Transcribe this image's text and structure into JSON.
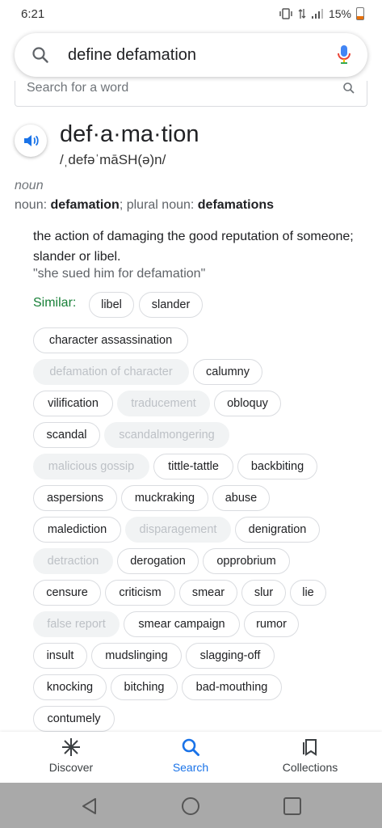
{
  "status": {
    "time": "6:21",
    "battery": "15%"
  },
  "search": {
    "query": "define defamation"
  },
  "dictionary": {
    "placeholder": "Search for a word"
  },
  "entry": {
    "word": "def·a·ma·tion",
    "phonetic": "/ˌdefəˈmāSH(ə)n/",
    "part_of_speech": "noun",
    "forms_prefix": "noun: ",
    "form_singular": "defamation",
    "forms_mid": "; plural noun: ",
    "form_plural": "defamations",
    "definition": "the action of damaging the good reputation of someone; slander or libel.",
    "example": "\"she sued him for defamation\"",
    "similar_label": "Similar:",
    "similar": [
      {
        "label": "libel",
        "dim": false
      },
      {
        "label": "slander",
        "dim": false
      },
      {
        "label": "character assassination",
        "dim": false
      },
      {
        "label": "defamation of character",
        "dim": true
      },
      {
        "label": "calumny",
        "dim": false
      },
      {
        "label": "vilification",
        "dim": false
      },
      {
        "label": "traducement",
        "dim": true
      },
      {
        "label": "obloquy",
        "dim": false
      },
      {
        "label": "scandal",
        "dim": false
      },
      {
        "label": "scandalmongering",
        "dim": true
      },
      {
        "label": "malicious gossip",
        "dim": true
      },
      {
        "label": "tittle-tattle",
        "dim": false
      },
      {
        "label": "backbiting",
        "dim": false
      },
      {
        "label": "aspersions",
        "dim": false
      },
      {
        "label": "muckraking",
        "dim": false
      },
      {
        "label": "abuse",
        "dim": false
      },
      {
        "label": "malediction",
        "dim": false
      },
      {
        "label": "disparagement",
        "dim": true
      },
      {
        "label": "denigration",
        "dim": false
      },
      {
        "label": "detraction",
        "dim": true
      },
      {
        "label": "derogation",
        "dim": false
      },
      {
        "label": "opprobrium",
        "dim": false
      },
      {
        "label": "censure",
        "dim": false
      },
      {
        "label": "criticism",
        "dim": false
      },
      {
        "label": "smear",
        "dim": false
      },
      {
        "label": "slur",
        "dim": false
      },
      {
        "label": "lie",
        "dim": false
      },
      {
        "label": "false report",
        "dim": true
      },
      {
        "label": "smear campaign",
        "dim": false
      },
      {
        "label": "rumor",
        "dim": false
      },
      {
        "label": "insult",
        "dim": false
      },
      {
        "label": "mudslinging",
        "dim": false
      },
      {
        "label": "slagging-off",
        "dim": false
      },
      {
        "label": "knocking",
        "dim": false
      },
      {
        "label": "bitching",
        "dim": false
      },
      {
        "label": "bad-mouthing",
        "dim": false
      },
      {
        "label": "contumely",
        "dim": false
      }
    ]
  },
  "bottom_nav": [
    {
      "label": "Discover",
      "icon": "asterisk-icon",
      "active": false
    },
    {
      "label": "Search",
      "icon": "search-icon",
      "active": true
    },
    {
      "label": "Collections",
      "icon": "collections-icon",
      "active": false
    }
  ],
  "colors": {
    "accent": "#1a73e8",
    "similar_label": "#188038"
  }
}
